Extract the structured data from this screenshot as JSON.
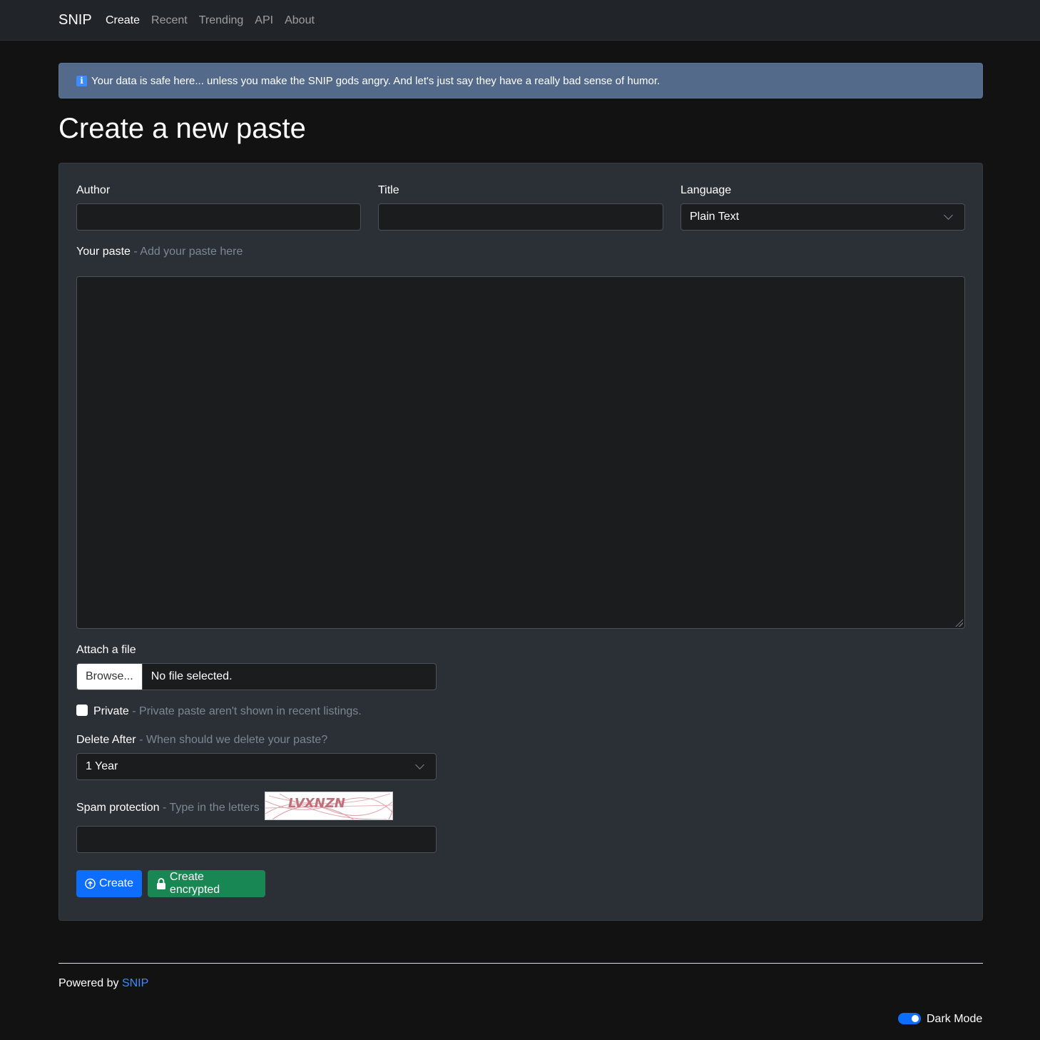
{
  "nav": {
    "brand": "SNIP",
    "items": [
      {
        "label": "Create",
        "active": true
      },
      {
        "label": "Recent"
      },
      {
        "label": "Trending"
      },
      {
        "label": "API"
      },
      {
        "label": "About"
      }
    ]
  },
  "alert": {
    "icon": "info-icon",
    "text": "Your data is safe here... unless you make the SNIP gods angry. And let's just say they have a really bad sense of humor."
  },
  "page": {
    "title": "Create a new paste"
  },
  "form": {
    "author_label": "Author",
    "author_value": "",
    "title_label": "Title",
    "title_value": "",
    "language_label": "Language",
    "language_value": "Plain Text",
    "paste_label": "Your paste",
    "paste_hint": "- Add your paste here",
    "attach_label": "Attach a file",
    "browse_label": "Browse...",
    "file_status": "No file selected.",
    "private_label": "Private",
    "private_hint": "- Private paste aren't shown in recent listings.",
    "delete_label": "Delete After",
    "delete_hint": "- When should we delete your paste?",
    "delete_value": "1 Year",
    "spam_label": "Spam protection",
    "spam_hint": "- Type in the letters",
    "captcha_text": "LVXNZN",
    "create_label": "Create",
    "create_encrypted_label": "Create encrypted"
  },
  "footer": {
    "powered_prefix": "Powered by",
    "powered_link": "SNIP",
    "dark_mode_label": "Dark Mode"
  },
  "colors": {
    "primary": "#0d6efd",
    "success": "#198754",
    "link": "#3d8bfd"
  }
}
